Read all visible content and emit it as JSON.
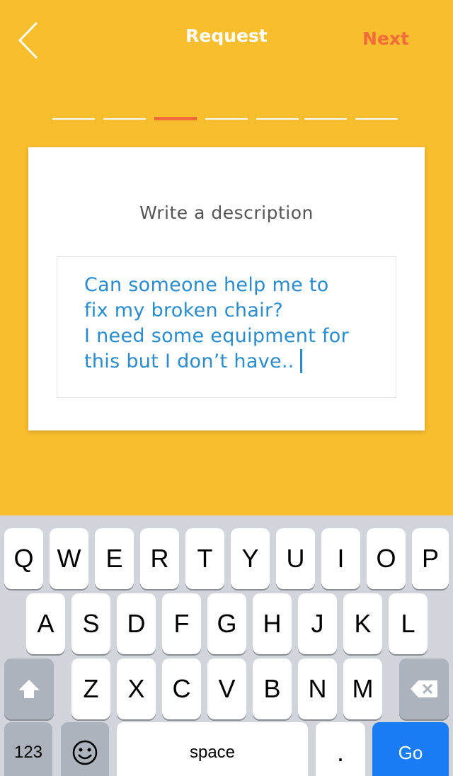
{
  "header": {
    "title": "Request",
    "next_label": "Next"
  },
  "progress": {
    "total_steps": 7,
    "current_step": 3
  },
  "card": {
    "heading": "Write a description",
    "description": "Can someone help me to\nfix my broken chair?\nI need some equipment for\nthis but I don’t have.."
  },
  "keyboard": {
    "row1": [
      "Q",
      "W",
      "E",
      "R",
      "T",
      "Y",
      "U",
      "I",
      "O",
      "P"
    ],
    "row2": [
      "A",
      "S",
      "D",
      "F",
      "G",
      "H",
      "J",
      "K",
      "L"
    ],
    "row3": [
      "Z",
      "X",
      "C",
      "V",
      "B",
      "N",
      "M"
    ],
    "numbers_label": "123",
    "space_label": "space",
    "period_label": ".",
    "go_label": "Go"
  },
  "colors": {
    "background": "#F9BE2E",
    "accent": "#F26B3A",
    "text_blue": "#2B8BCB",
    "go_blue": "#1A7CF4"
  }
}
